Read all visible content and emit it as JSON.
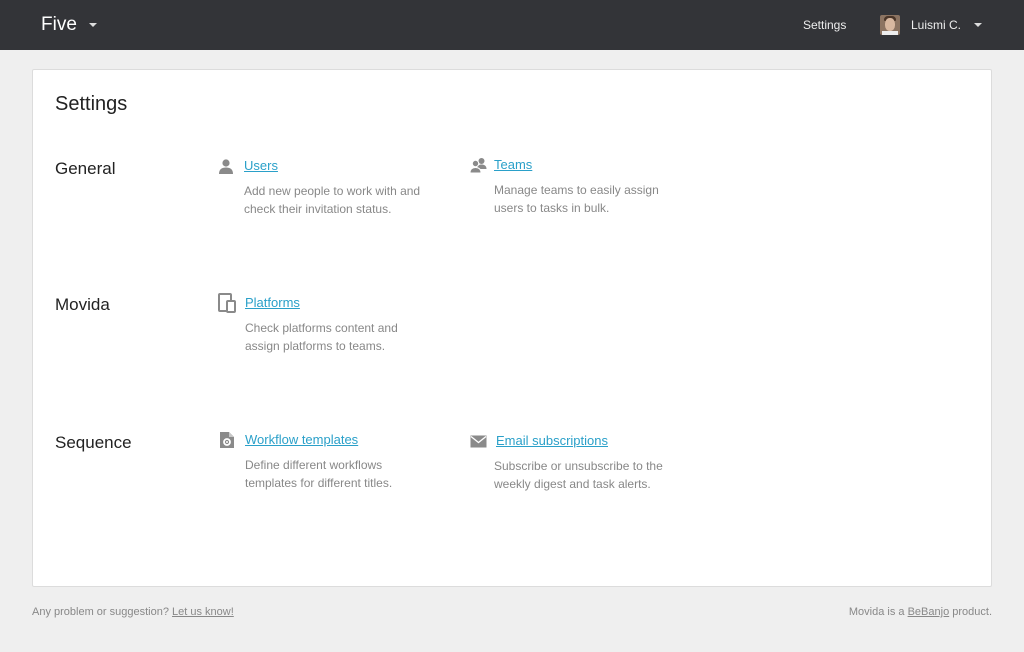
{
  "topbar": {
    "brand": "Five",
    "settings_label": "Settings",
    "user_name": "Luismi C."
  },
  "page_title": "Settings",
  "sections": [
    {
      "title": "General",
      "items": [
        {
          "icon": "user-icon",
          "label": "Users",
          "description": "Add new people to work with and check their invitation status."
        },
        {
          "icon": "team-icon",
          "label": "Teams",
          "description": "Manage teams to easily assign users to tasks in bulk."
        }
      ]
    },
    {
      "title": "Movida",
      "items": [
        {
          "icon": "devices-icon",
          "label": "Platforms",
          "description": "Check platforms content and assign platforms to teams."
        }
      ]
    },
    {
      "title": "Sequence",
      "items": [
        {
          "icon": "document-gear-icon",
          "label": "Workflow templates",
          "description": "Define different workflows templates for different titles."
        },
        {
          "icon": "envelope-icon",
          "label": "Email subscriptions",
          "description": "Subscribe or unsubscribe to the weekly digest and task alerts."
        }
      ]
    }
  ],
  "footer": {
    "left_text": "Any problem or suggestion?",
    "left_link": "Let us know!",
    "right_prefix": "Movida is a",
    "right_link": "BeBanjo",
    "right_suffix": "product."
  },
  "colors": {
    "topbar": "#333438",
    "background": "#efefef",
    "link": "#2aa0c9",
    "muted_text": "#888888"
  }
}
